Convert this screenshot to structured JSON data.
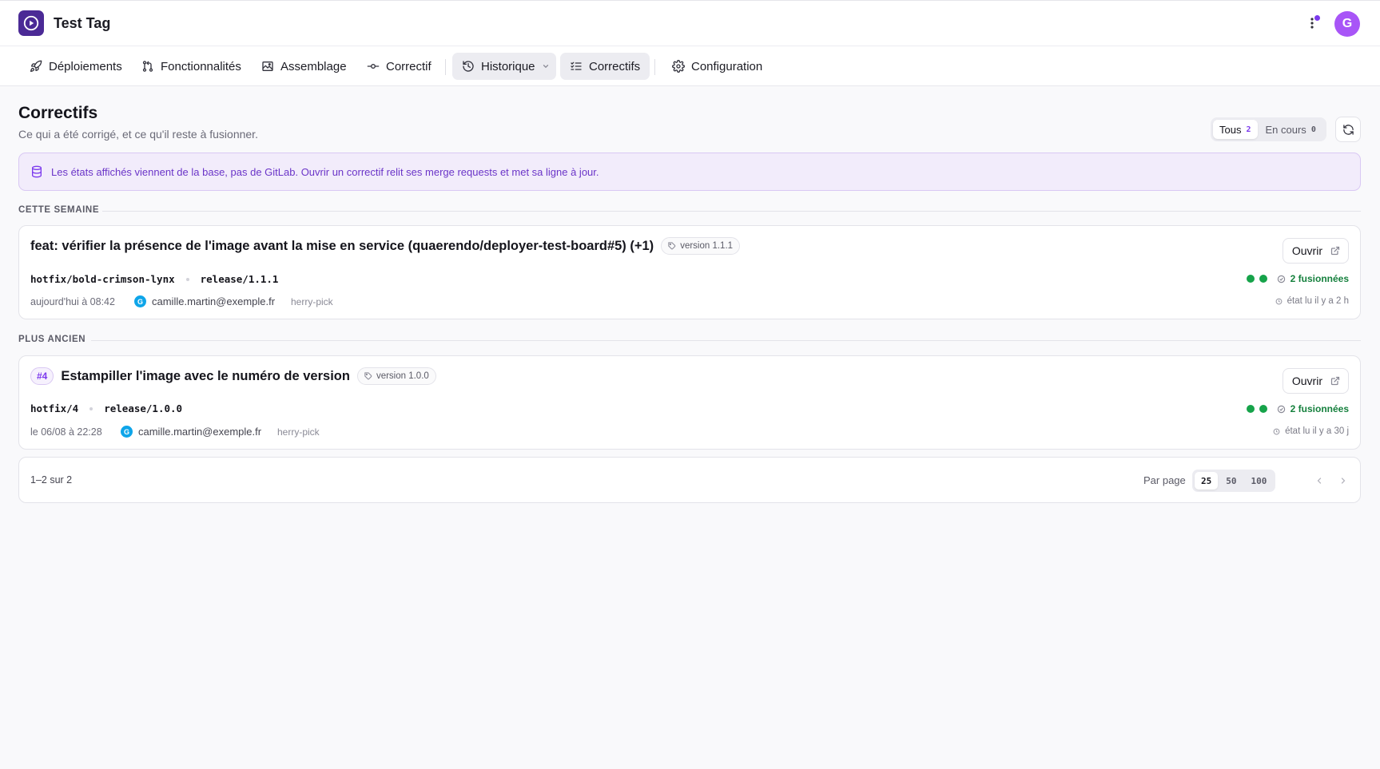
{
  "app": {
    "title": "Test Tag",
    "logo_icon": "play-logo-icon",
    "avatar_initial": "G",
    "colors": {
      "brand": "#4b2a96",
      "accent": "#7c3aed",
      "avatar": "#a855f7",
      "success": "#16a34a"
    }
  },
  "nav": {
    "items": [
      {
        "label": "Déploiements",
        "icon": "rocket-icon"
      },
      {
        "label": "Fonctionnalités",
        "icon": "git-pull-request-icon"
      },
      {
        "label": "Assemblage",
        "icon": "image-frame-icon"
      },
      {
        "label": "Correctif",
        "icon": "git-commit-icon"
      },
      {
        "label": "Historique",
        "icon": "history-icon"
      },
      {
        "label": "Correctifs",
        "icon": "list-checks-icon"
      },
      {
        "label": "Configuration",
        "icon": "gear-icon"
      }
    ]
  },
  "page": {
    "title": "Correctifs",
    "subtitle": "Ce qui a été corrigé, et ce qu'il reste à fusionner."
  },
  "filters": [
    {
      "label": "Tous",
      "count": "2",
      "active": true
    },
    {
      "label": "En cours",
      "count": "0",
      "active": false
    }
  ],
  "banner": {
    "text": "Les états affichés viennent de la base, pas de GitLab. Ouvrir un correctif relit ses merge requests et met sa ligne à jour."
  },
  "sections": [
    {
      "label": "CETTE SEMAINE",
      "items": [
        {
          "number": "",
          "title": "feat: vérifier la présence de l'image avant la mise en service (quaerendo/deployer-test-board#5) (+1)",
          "version": "version 1.1.1",
          "source_branch": "hotfix/bold-crimson-lynx",
          "target_branch": "release/1.1.1",
          "date": "aujourd'hui à 08:42",
          "author_initial": "G",
          "author": "camille.martin@exemple.fr",
          "kind": "herry-pick",
          "open_label": "Ouvrir",
          "merged": "2 fusionnées",
          "read": "état lu il y a 2 h"
        }
      ]
    },
    {
      "label": "PLUS ANCIEN",
      "items": [
        {
          "number": "#4",
          "title": "Estampiller l'image avec le numéro de version",
          "version": "version 1.0.0",
          "source_branch": "hotfix/4",
          "target_branch": "release/1.0.0",
          "date": "le 06/08 à 22:28",
          "author_initial": "G",
          "author": "camille.martin@exemple.fr",
          "kind": "herry-pick",
          "open_label": "Ouvrir",
          "merged": "2 fusionnées",
          "read": "état lu il y a 30 j"
        }
      ]
    }
  ],
  "pagination": {
    "range": "1–2 sur 2",
    "per_page_label": "Par page",
    "options": [
      "25",
      "50",
      "100"
    ],
    "selected": "25"
  }
}
